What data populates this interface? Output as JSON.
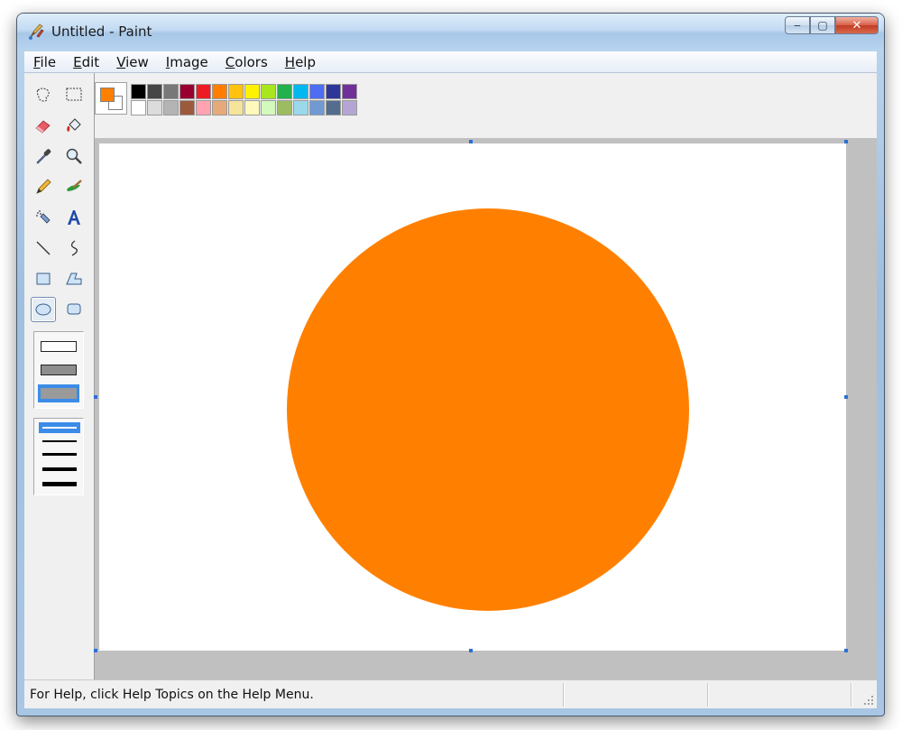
{
  "window": {
    "title": "Untitled - Paint",
    "minimize_glyph": "‒",
    "maximize_glyph": "▢",
    "close_glyph": "✕"
  },
  "menu": {
    "items": [
      "File",
      "Edit",
      "View",
      "Image",
      "Colors",
      "Help"
    ]
  },
  "toolbox": {
    "tools": [
      "free-form-select",
      "select",
      "eraser",
      "fill-with-color",
      "pick-color",
      "magnifier",
      "pencil",
      "brush",
      "airbrush",
      "text",
      "line",
      "curve",
      "rectangle",
      "polygon",
      "ellipse",
      "rounded-rectangle"
    ],
    "selected_tool": "ellipse",
    "fill_styles": [
      "outline",
      "outline-fill",
      "fill"
    ],
    "selected_fill_style": "fill",
    "line_widths": [
      1,
      2,
      3,
      4,
      5
    ],
    "selected_line_width": 1
  },
  "colors": {
    "foreground": "#ff8000",
    "background": "#ffffff",
    "palette_top": [
      "#000000",
      "#464646",
      "#787878",
      "#990030",
      "#ed1c24",
      "#ff7e00",
      "#ffc20e",
      "#fff200",
      "#a8e61d",
      "#22b14c",
      "#00b7ef",
      "#4d6df3",
      "#2f3699",
      "#6f3198"
    ],
    "palette_bottom": [
      "#ffffff",
      "#dcdcdc",
      "#b4b4b4",
      "#9c5a3c",
      "#ffa3b1",
      "#e5aa7a",
      "#f5e49c",
      "#fff9bd",
      "#d3f9bc",
      "#9dbb61",
      "#99d9ea",
      "#709ad1",
      "#546d8e",
      "#b5a5d5"
    ],
    "ellipse_fill": "#ff8000"
  },
  "status": {
    "help_text": "For Help, click Help Topics on the Help Menu."
  }
}
